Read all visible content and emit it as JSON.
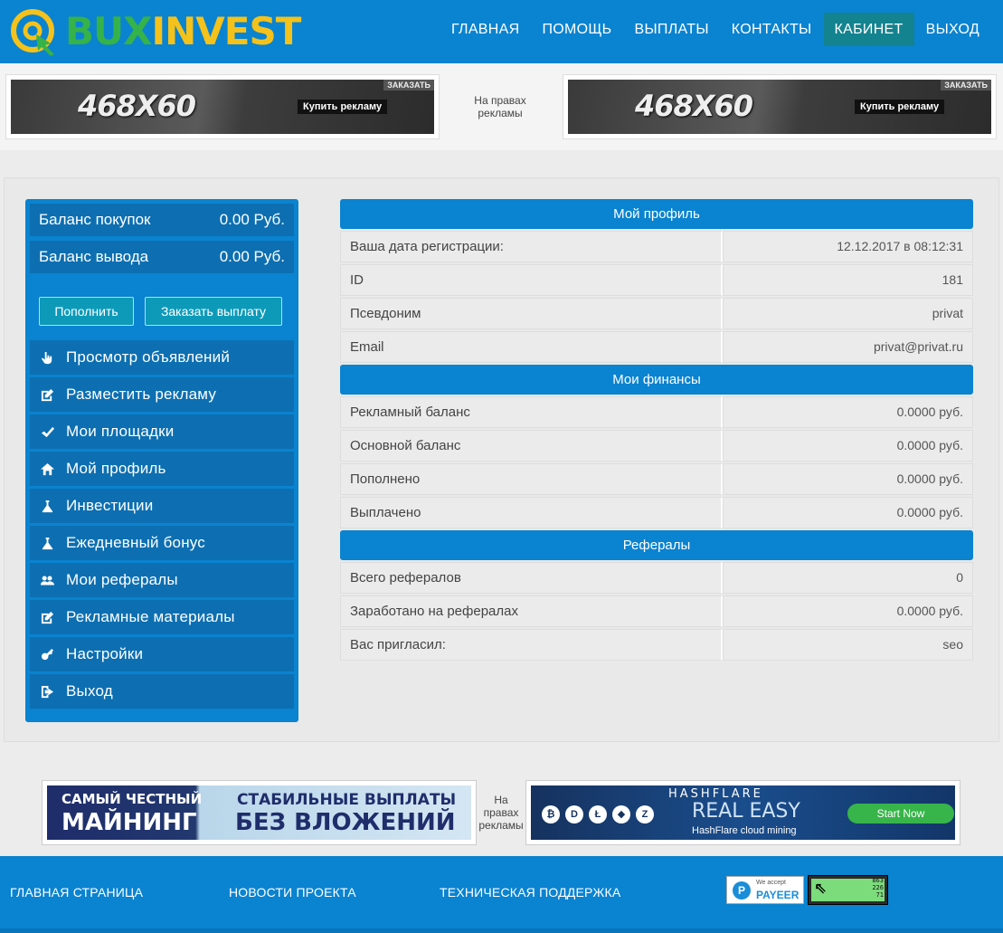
{
  "logo": {
    "part1": "BUX",
    "part2": "INVEST"
  },
  "nav": [
    {
      "label": "ГЛАВНАЯ"
    },
    {
      "label": "ПОМОЩЬ"
    },
    {
      "label": "ВЫПЛАТЫ"
    },
    {
      "label": "КОНТАКТЫ"
    },
    {
      "label": "КАБИНЕТ"
    },
    {
      "label": "ВЫХОД"
    }
  ],
  "ads_top": {
    "banner_size": "468X60",
    "banner_buy": "Купить рекламу",
    "banner_order": "ЗАКАЗАТЬ",
    "note": "На правах рекламы"
  },
  "balances": [
    {
      "label": "Баланс покупок",
      "value": "0.00 Руб."
    },
    {
      "label": "Баланс вывода",
      "value": "0.00 Руб."
    }
  ],
  "buttons": {
    "topup": "Пополнить",
    "withdraw": "Заказать выплату"
  },
  "menu": [
    {
      "label": "Просмотр объявлений",
      "icon": "pointer-icon"
    },
    {
      "label": "Разместить рекламу",
      "icon": "edit-icon"
    },
    {
      "label": "Мои площадки",
      "icon": "check-icon"
    },
    {
      "label": "Мой профиль",
      "icon": "home-icon"
    },
    {
      "label": "Инвестиции",
      "icon": "flask-icon"
    },
    {
      "label": "Ежедневный бонус",
      "icon": "flask-icon"
    },
    {
      "label": "Мои рефералы",
      "icon": "users-icon"
    },
    {
      "label": "Рекламные материалы",
      "icon": "edit-icon"
    },
    {
      "label": "Настройки",
      "icon": "key-icon"
    },
    {
      "label": "Выход",
      "icon": "logout-icon"
    }
  ],
  "profile": {
    "title": "Мой профиль",
    "rows": [
      {
        "k": "Ваша дата регистрации:",
        "v": "12.12.2017 в 08:12:31"
      },
      {
        "k": "ID",
        "v": "181"
      },
      {
        "k": "Псевдоним",
        "v": "privat"
      },
      {
        "k": "Email",
        "v": "privat@privat.ru"
      }
    ]
  },
  "finance": {
    "title": "Мои финансы",
    "rows": [
      {
        "k": "Рекламный баланс",
        "v": "0.0000 руб."
      },
      {
        "k": "Основной баланс",
        "v": "0.0000 руб."
      },
      {
        "k": "Пополнено",
        "v": "0.0000 руб."
      },
      {
        "k": "Выплачено",
        "v": "0.0000 руб."
      }
    ]
  },
  "referrals": {
    "title": "Рефералы",
    "rows": [
      {
        "k": "Всего рефералов",
        "v": "0"
      },
      {
        "k": "Заработано на рефералах",
        "v": "0.0000 руб."
      },
      {
        "k": "Вас пригласил:",
        "v": "seo"
      }
    ]
  },
  "ads_bottom": {
    "mining_line1": "САМЫЙ ЧЕСТНЫЙ",
    "mining_line2": "МАЙНИНГ",
    "stable_line1": "СТАБИЛЬНЫЕ ВЫПЛАТЫ",
    "stable_line2": "БЕЗ ВЛОЖЕНИЙ",
    "note": "На правах рекламы",
    "hf_logo": "HASHFLARE",
    "hf_big": "REAL EASY",
    "hf_sub": "HashFlare cloud mining",
    "hf_btn": "Start Now"
  },
  "footer": {
    "links": [
      "ГЛАВНАЯ СТРАНИЦА",
      "НОВОСТИ ПРОЕКТА",
      "ТЕХНИЧЕСКАЯ ПОДДЕРЖКА"
    ],
    "payeer_accept": "We accept",
    "payeer_name": "PAYEER",
    "counter_nums": [
      "863",
      "226",
      "71"
    ]
  },
  "colors": {
    "primary": "#0a83d0",
    "dark_row": "#0d6fb1",
    "active_nav": "#13838f",
    "logo_green": "#35b24a",
    "logo_yellow": "#f4c21b"
  }
}
